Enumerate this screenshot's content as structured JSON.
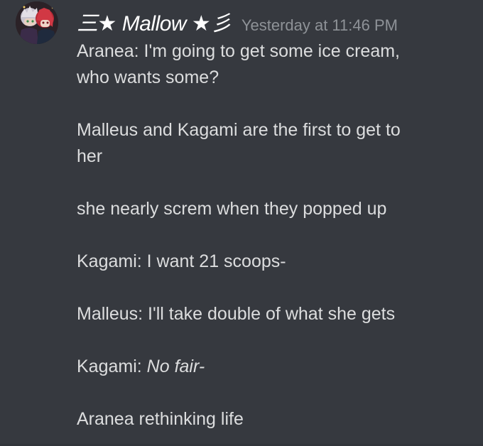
{
  "message": {
    "author": {
      "display_name": "三★ Mallow ★彡",
      "avatar_icon": "avatar-icon"
    },
    "timestamp": "Yesterday at 11:46 PM",
    "lines": {
      "l1a": "Aranea: I'm going to get some ice cream,",
      "l1b": "who wants some?",
      "l2a": "Malleus and Kagami are the first to get to",
      "l2b": "her",
      "l3": "she nearly screm when they popped up",
      "l4": "Kagami: I want 21 scoops-",
      "l5": "Malleus: I'll take double of what she gets",
      "l6_prefix": "Kagami: ",
      "l6_italic": "No fair-",
      "l7": "Aranea rethinking life"
    }
  },
  "colors": {
    "background": "#36393f",
    "username": "#ffffff",
    "text": "#dcddde",
    "timestamp": "#8e9297"
  }
}
